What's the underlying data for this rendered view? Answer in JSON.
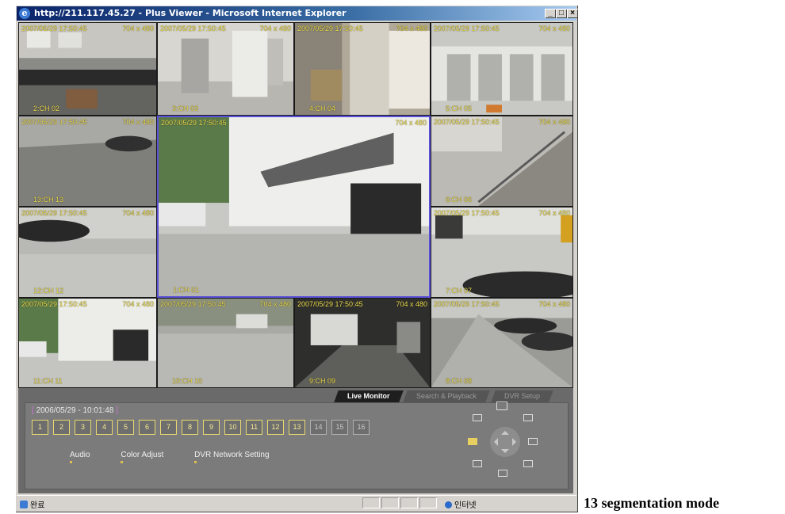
{
  "window": {
    "title": "http://211.117.45.27 - Plus Viewer - Microsoft Internet Explorer",
    "controls": {
      "minimize": "_",
      "maximize": "□",
      "close": "×"
    }
  },
  "cameras": {
    "top1": {
      "ts": "2007/05/29 17:50:45",
      "res": "704 x 480",
      "label": "2:CH 02"
    },
    "top2": {
      "ts": "2007/05/29 17:50:45",
      "res": "704 x 480",
      "label": "3:CH 03"
    },
    "top3": {
      "ts": "2007/05/29 17:50:45",
      "res": "704 x 480",
      "label": "4:CH 04"
    },
    "top4": {
      "ts": "2007/05/29 17:50:45",
      "res": "704 x 480",
      "label": "5:CH 05"
    },
    "l1": {
      "ts": "2007/05/29 17:50:45",
      "res": "704 x 480",
      "label": "13:CH 13"
    },
    "main": {
      "ts": "2007/05/29 17:50:45",
      "res": "704 x 480",
      "label": "1:CH 01"
    },
    "r1": {
      "ts": "2007/05/29 17:50:45",
      "res": "704 x 480",
      "label": "6:CH 06"
    },
    "l2": {
      "ts": "2007/05/29 17:50:45",
      "res": "704 x 480",
      "label": "12:CH 12"
    },
    "r2": {
      "ts": "2007/05/29 17:50:45",
      "res": "704 x 480",
      "label": "7:CH 07"
    },
    "b1": {
      "ts": "2007/05/29 17:50:45",
      "res": "704 x 480",
      "label": "11:CH 11"
    },
    "b2": {
      "ts": "2007/05/29 17:50:45",
      "res": "704 x 480",
      "label": "10:CH 10"
    },
    "b3": {
      "ts": "2007/05/29 17:50:45",
      "res": "704 x 480",
      "label": "9:CH 09"
    },
    "b4": {
      "ts": "2007/05/29 17:50:45",
      "res": "704 x 480",
      "label": "8:CH 08"
    }
  },
  "tabs": [
    "Live Monitor",
    "Search & Playback",
    "DVR Setup"
  ],
  "clock": {
    "open": "[",
    "value": "2006/05/29 - 10:01:48",
    "close": "]"
  },
  "channels": [
    "1",
    "2",
    "3",
    "4",
    "5",
    "6",
    "7",
    "8",
    "9",
    "10",
    "11",
    "12",
    "13",
    "14",
    "15",
    "16"
  ],
  "active_channels": 13,
  "menu": {
    "audio": "Audio",
    "color": "Color Adjust",
    "network": "DVR Network Setting"
  },
  "statusbar": {
    "done": "완료",
    "zone": "인터넷"
  },
  "caption": "13 segmentation mode",
  "colors": {
    "overlay_text": "#f0e050",
    "main_border": "#5a4fd8",
    "selected": "#e8d060"
  }
}
